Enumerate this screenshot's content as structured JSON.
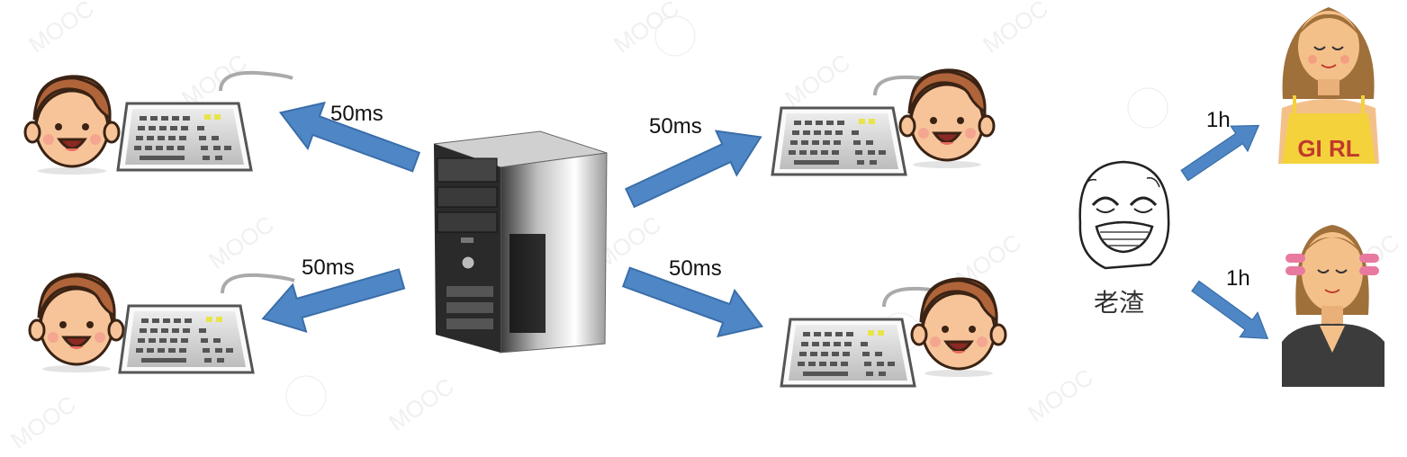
{
  "labels": {
    "left_top": "50ms",
    "left_bottom": "50ms",
    "right_top": "50ms",
    "right_bottom": "50ms",
    "girl_top": "1h",
    "girl_bottom": "1h",
    "scumbag": "老渣",
    "girl_shirt": "GI RL"
  },
  "watermark": {
    "text": "MOOC"
  },
  "colors": {
    "arrow": "#4f86c6",
    "arrow_stroke": "#3a6ea8",
    "skin": "#f7c49a",
    "hair": "#b0643a",
    "keyboard": "#c9cbce",
    "girl_hair": "#a0703a",
    "yellow_top": "#f4d23c"
  },
  "icons": [
    "boy-face-icon",
    "keyboard-icon",
    "server-tower-icon",
    "rage-face-icon",
    "girl-portrait-icon"
  ]
}
